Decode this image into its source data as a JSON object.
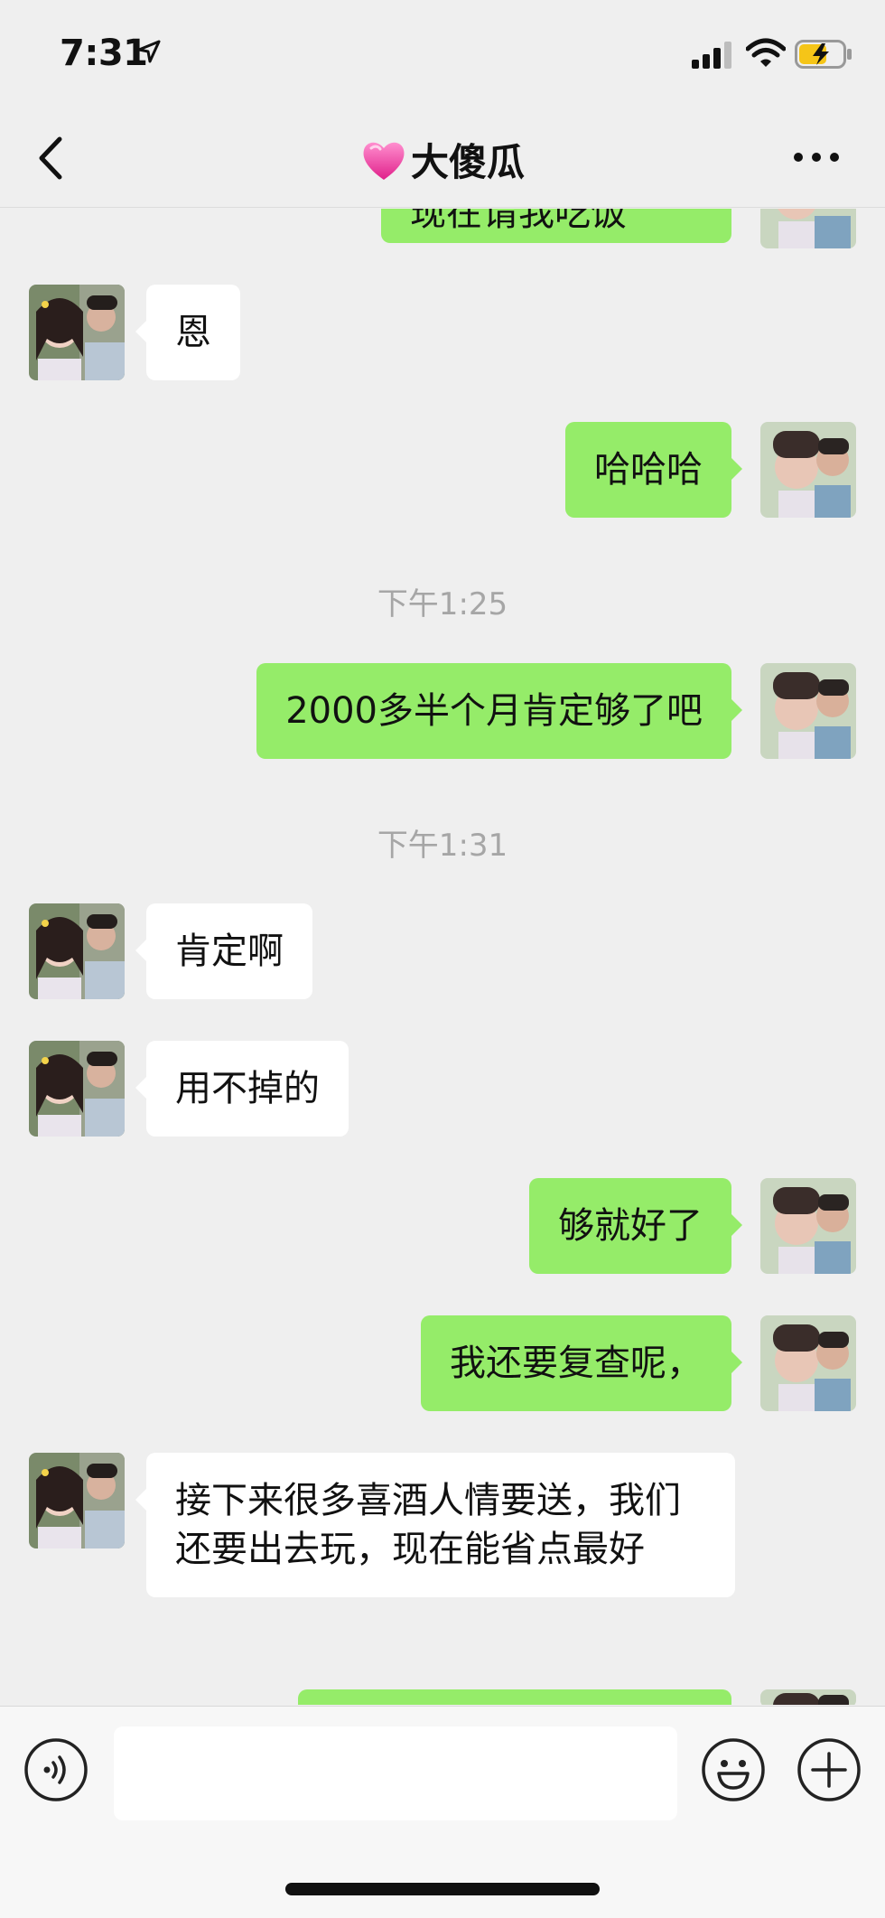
{
  "status_bar": {
    "time": "7:31"
  },
  "nav": {
    "title": "大傻瓜"
  },
  "messages": [
    {
      "side": "right",
      "text": "现在请我吃饭",
      "partial": true
    },
    {
      "side": "left",
      "text": "恩"
    },
    {
      "side": "right",
      "text": "哈哈哈"
    },
    {
      "type": "time",
      "text": "下午1:25"
    },
    {
      "side": "right",
      "text": "2000多半个月肯定够了吧"
    },
    {
      "type": "time",
      "text": "下午1:31"
    },
    {
      "side": "left",
      "text": "肯定啊"
    },
    {
      "side": "left",
      "text": "用不掉的"
    },
    {
      "side": "right",
      "text": "够就好了"
    },
    {
      "side": "right",
      "text": "我还要复查呢，"
    },
    {
      "side": "left",
      "text": "接下来很多喜酒人情要送，我们还要出去玩，现在能省点最好"
    }
  ],
  "colors": {
    "sent_bubble": "#95ec69",
    "received_bubble": "#ffffff",
    "background": "#efefef"
  }
}
